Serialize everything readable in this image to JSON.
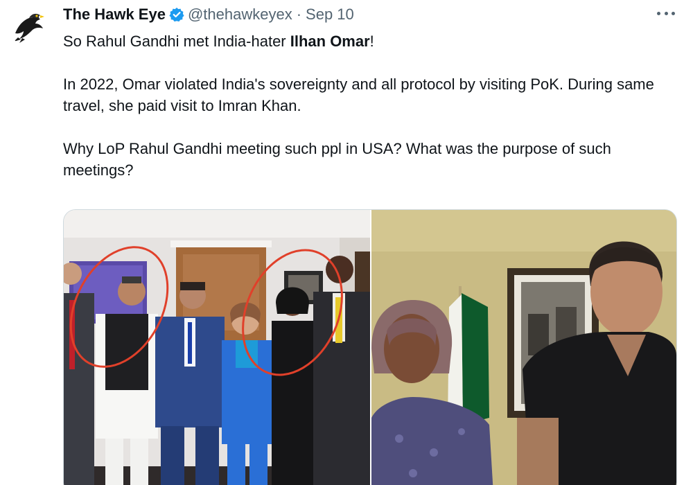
{
  "tweet": {
    "author_name": "The Hawk Eye",
    "handle": "@thehawkeyex",
    "separator": "·",
    "date": "Sep 10",
    "text_line1_pre": "So Rahul Gandhi met India-hater ",
    "text_line1_bold": "Ilhan Omar",
    "text_line1_post": "!",
    "paragraph2": "In 2022, Omar violated India's sovereignty and all protocol by visiting PoK. During same travel, she paid visit to Imran Khan.",
    "paragraph3": "Why LoP Rahul Gandhi meeting such ppl in USA? What was the purpose of such meetings?"
  },
  "icons": {
    "verified": "verified-badge-icon",
    "more": "more-options-icon",
    "avatar": "hawk-avatar"
  },
  "colors": {
    "verified_blue": "#1d9bf0",
    "text_primary": "#0f1419",
    "text_secondary": "#536471",
    "annotation_red": "#e0402a"
  }
}
